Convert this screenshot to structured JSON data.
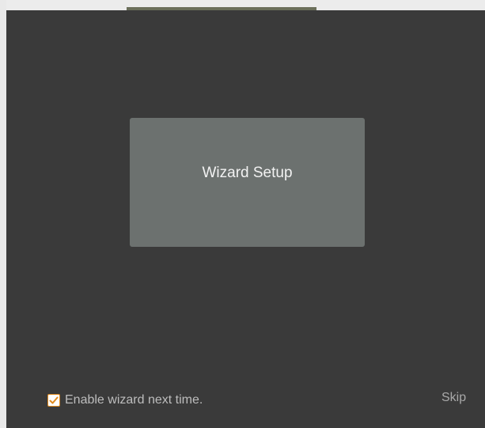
{
  "wizard": {
    "tile_label": "Wizard Setup"
  },
  "footer": {
    "enable_label": "Enable wizard next time.",
    "enable_checked": true,
    "skip_label": "Skip"
  },
  "colors": {
    "background": "#3a3a3a",
    "tile": "#6c716f",
    "checkbox_accent": "#e08a1e"
  },
  "icons": {
    "checkbox": "checkmark-icon"
  }
}
